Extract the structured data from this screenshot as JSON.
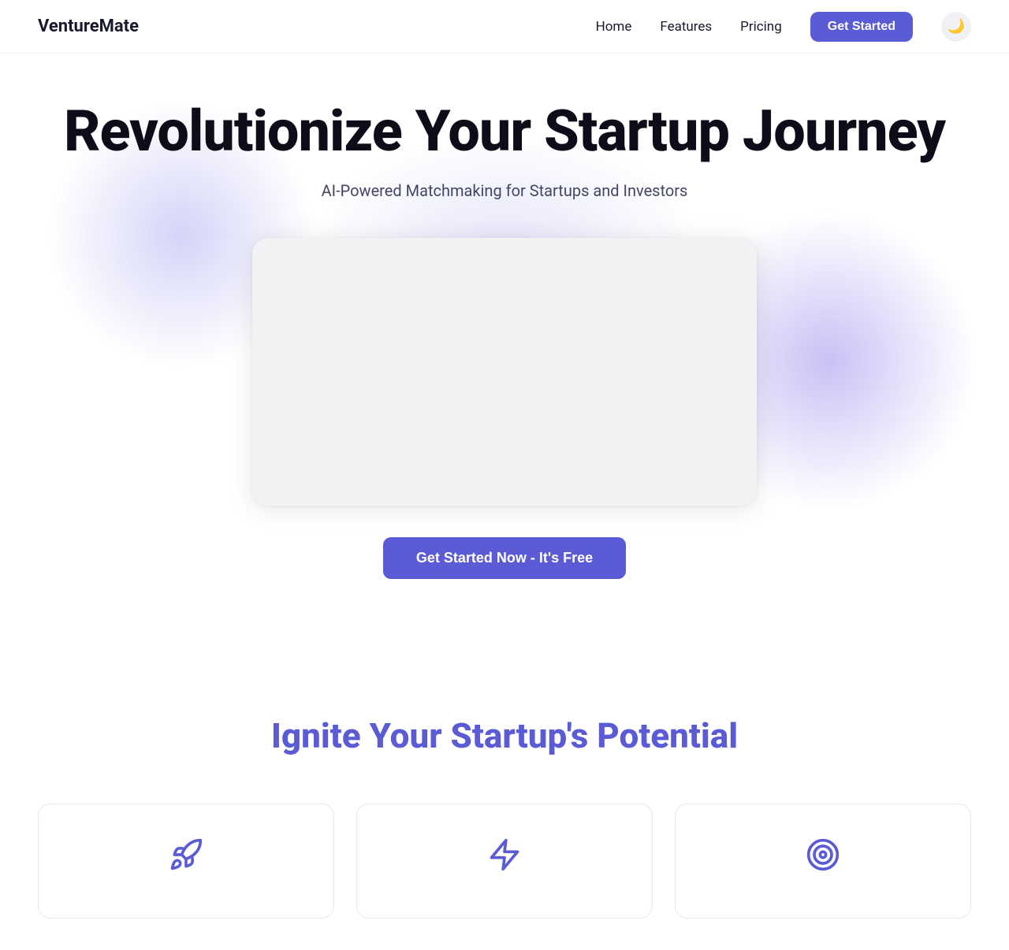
{
  "nav": {
    "logo": "VentureMate",
    "links": [
      {
        "label": "Home",
        "id": "home"
      },
      {
        "label": "Features",
        "id": "features"
      },
      {
        "label": "Pricing",
        "id": "pricing"
      }
    ],
    "cta_label": "Get Started",
    "theme_icon": "🌙"
  },
  "hero": {
    "title": "Revolutionize Your Startup Journey",
    "subtitle": "AI-Powered Matchmaking for Startups and Investors",
    "cta_label": "Get Started Now - It's Free"
  },
  "features": {
    "title": "Ignite Your Startup's Potential",
    "cards": [
      {
        "id": "rocket",
        "color": "#5b5bd6"
      },
      {
        "id": "bolt",
        "color": "#5b5bd6"
      },
      {
        "id": "target",
        "color": "#5b5bd6"
      }
    ]
  }
}
